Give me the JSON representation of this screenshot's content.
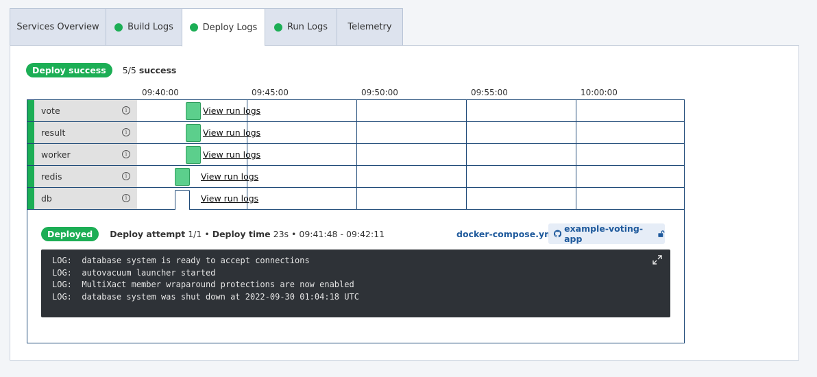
{
  "tabs": [
    {
      "label": "Services Overview",
      "status": false
    },
    {
      "label": "Build Logs",
      "status": true
    },
    {
      "label": "Deploy Logs",
      "status": true
    },
    {
      "label": "Run Logs",
      "status": true
    },
    {
      "label": "Telemetry",
      "status": false
    }
  ],
  "status": {
    "badge": "Deploy success",
    "count": "5/5",
    "count_suffix": "success"
  },
  "axis": [
    "09:40:00",
    "09:45:00",
    "09:50:00",
    "09:55:00",
    "10:00:00"
  ],
  "services": [
    {
      "name": "vote",
      "link": "View run logs"
    },
    {
      "name": "result",
      "link": "View run logs"
    },
    {
      "name": "worker",
      "link": "View run logs"
    },
    {
      "name": "redis",
      "link": "View run logs"
    },
    {
      "name": "db",
      "link": "View run logs"
    }
  ],
  "detail": {
    "badge": "Deployed",
    "attempt_label": "Deploy attempt",
    "attempt_value": "1/1",
    "sep": "•",
    "time_label": "Deploy time",
    "time_value": "23s • 09:41:48 - 09:42:11",
    "compose_file": "docker-compose.yml",
    "repo": "example-voting-app"
  },
  "logs": [
    "LOG:  database system is ready to accept connections",
    "LOG:  autovacuum launcher started",
    "LOG:  MultiXact member wraparound protections are now enabled",
    "LOG:  database system was shut down at 2022-09-30 01:04:18 UTC"
  ],
  "colors": {
    "accent": "#1cae55",
    "bar": "#5ccf8c",
    "grid": "#1f4a78",
    "link": "#1f5a9c"
  }
}
